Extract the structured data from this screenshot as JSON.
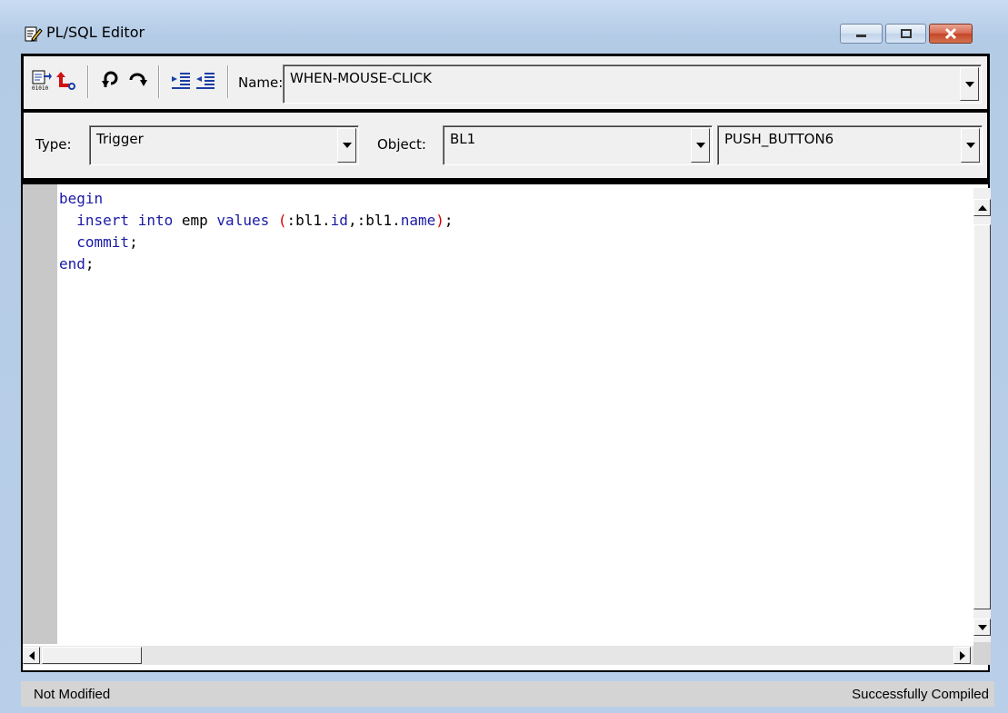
{
  "window": {
    "title": "PL/SQL Editor",
    "icon": "pencil-edit-icon",
    "controls": [
      "minimize-icon",
      "maximize-icon",
      "close-icon"
    ]
  },
  "toolbar": {
    "tools": [
      "compile-icon",
      "revert-icon",
      "undo-icon",
      "redo-icon",
      "indent-icon",
      "outdent-icon"
    ],
    "name_label": "Name:",
    "name_value": "WHEN-MOUSE-CLICK"
  },
  "selectors": {
    "type_label": "Type:",
    "type_value": "Trigger",
    "object_label": "Object:",
    "object_value": "BL1",
    "item_value": "PUSH_BUTTON6"
  },
  "editor": {
    "lines": [
      "begin",
      "  insert into emp values (:bl1.id,:bl1.name);",
      "  commit;",
      "end;"
    ]
  },
  "status": {
    "left": "Not Modified",
    "right": "Successfully Compiled"
  },
  "colors": {
    "keyword": "#1a1aa6",
    "punctuation": "#d40000",
    "titlebar": "#c9dcf2"
  }
}
